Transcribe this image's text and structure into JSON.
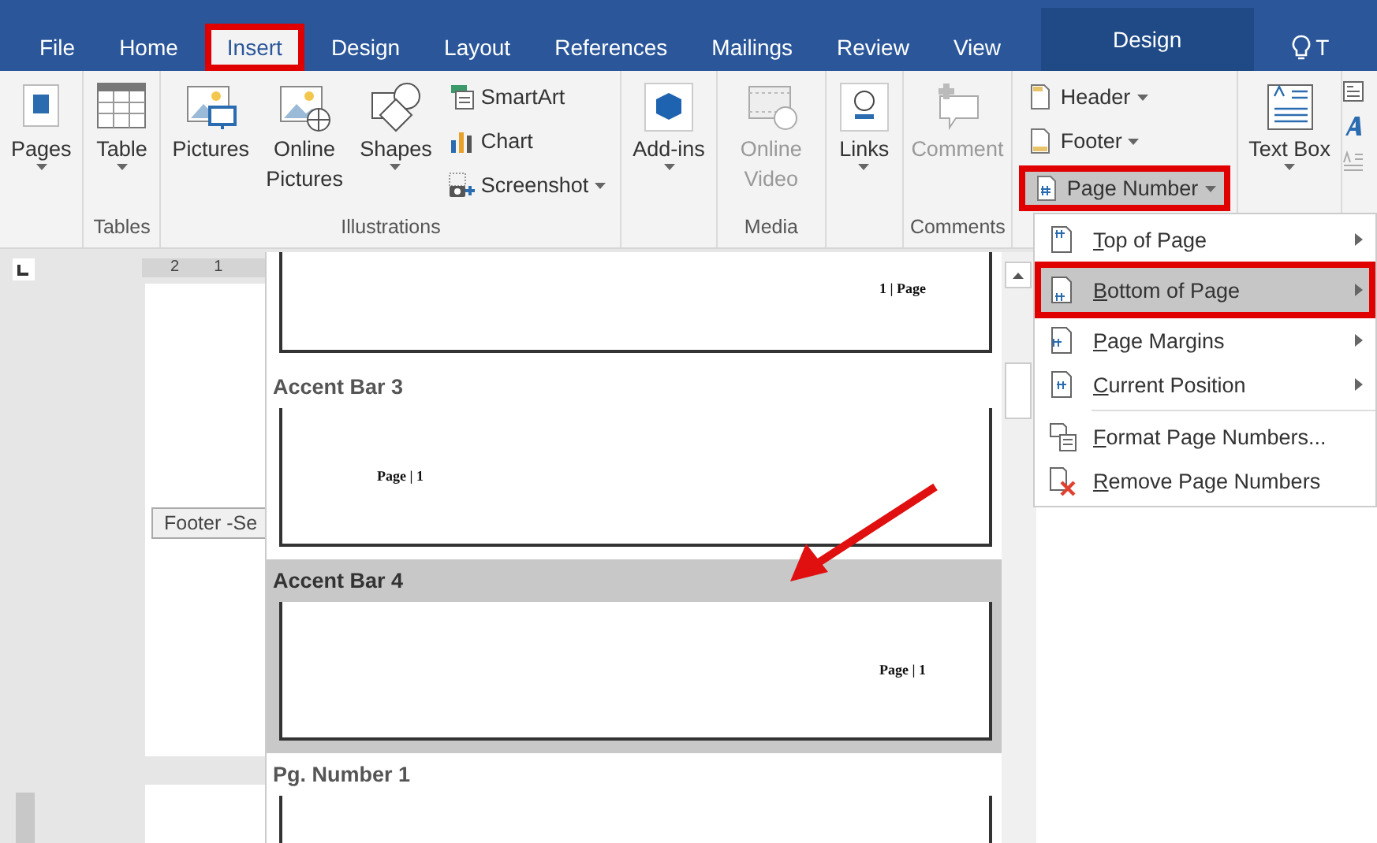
{
  "tabs": [
    {
      "label": "File",
      "selected": false,
      "highlighted": false,
      "kind": "normal"
    },
    {
      "label": "Home",
      "selected": false,
      "highlighted": false,
      "kind": "normal"
    },
    {
      "label": "Insert",
      "selected": true,
      "highlighted": true,
      "kind": "normal"
    },
    {
      "label": "Design",
      "selected": false,
      "highlighted": false,
      "kind": "normal"
    },
    {
      "label": "Layout",
      "selected": false,
      "highlighted": false,
      "kind": "normal"
    },
    {
      "label": "References",
      "selected": false,
      "highlighted": false,
      "kind": "normal"
    },
    {
      "label": "Mailings",
      "selected": false,
      "highlighted": false,
      "kind": "normal"
    },
    {
      "label": "Review",
      "selected": false,
      "highlighted": false,
      "kind": "normal"
    },
    {
      "label": "View",
      "selected": false,
      "highlighted": false,
      "kind": "normal"
    },
    {
      "label": "Design",
      "selected": false,
      "highlighted": false,
      "kind": "contextual"
    }
  ],
  "tell_me": {
    "text": "T"
  },
  "ribbon": {
    "groups": [
      {
        "items": [
          {
            "kind": "large",
            "label": "Pages",
            "dropdown": true,
            "disabled": false
          }
        ]
      },
      {
        "label": "Tables",
        "items": [
          {
            "kind": "large",
            "label": "Table",
            "dropdown": true,
            "disabled": false
          }
        ]
      },
      {
        "label": "Illustrations",
        "items": [
          {
            "kind": "large",
            "label": "Pictures",
            "dropdown": false,
            "disabled": false
          },
          {
            "kind": "large",
            "label": "Online Pictures",
            "dropdown": false,
            "disabled": false
          },
          {
            "kind": "large",
            "label": "Shapes",
            "dropdown": true,
            "disabled": false
          },
          {
            "kind": "small",
            "label": "SmartArt",
            "dropdown": false,
            "disabled": false
          },
          {
            "kind": "small",
            "label": "Chart",
            "dropdown": false,
            "disabled": false
          },
          {
            "kind": "small",
            "label": "Screenshot",
            "dropdown": true,
            "disabled": false
          }
        ]
      },
      {
        "items": [
          {
            "kind": "large",
            "label": "Add-ins",
            "dropdown": true,
            "disabled": false
          }
        ]
      },
      {
        "label": "Media",
        "items": [
          {
            "kind": "large",
            "label": "Online Video",
            "dropdown": false,
            "disabled": true
          }
        ]
      },
      {
        "items": [
          {
            "kind": "large",
            "label": "Links",
            "dropdown": true,
            "disabled": false
          }
        ]
      },
      {
        "label": "Comments",
        "items": [
          {
            "kind": "large",
            "label": "Comment",
            "dropdown": false,
            "disabled": true
          }
        ]
      },
      {
        "items": [
          {
            "kind": "small",
            "label": "Header",
            "dropdown": true,
            "disabled": false,
            "highlighted": false
          },
          {
            "kind": "small",
            "label": "Footer",
            "dropdown": true,
            "disabled": false,
            "highlighted": false
          },
          {
            "kind": "small",
            "label": "Page Number",
            "dropdown": true,
            "disabled": false,
            "highlighted": true
          }
        ]
      },
      {
        "items": [
          {
            "kind": "large",
            "label": "Text Box",
            "dropdown": true,
            "disabled": false
          }
        ]
      }
    ]
  },
  "ruler": {
    "numbers": [
      "2",
      "1"
    ]
  },
  "footer_tag": {
    "text": "Footer -Se"
  },
  "gallery": {
    "entries": [
      {
        "preview": "1 | Page",
        "kind": "right",
        "selected": false
      },
      {
        "title": "Accent Bar 3",
        "preview": "Page | 1",
        "kind": "left",
        "selected": false
      },
      {
        "title": "Accent Bar 4",
        "preview": "Page | 1",
        "kind": "right",
        "selected": true
      },
      {
        "title": "Pg. Number 1",
        "selected": false
      }
    ]
  },
  "menu": {
    "items": [
      {
        "label": "Top of Page",
        "submenu": true,
        "selected": false,
        "highlighted": false
      },
      {
        "label": "Bottom of Page",
        "submenu": true,
        "selected": true,
        "highlighted": true
      },
      {
        "label": "Page Margins",
        "submenu": true,
        "selected": false,
        "highlighted": false
      },
      {
        "label": "Current Position",
        "submenu": true,
        "selected": false,
        "highlighted": false
      },
      {
        "label": "Format Page Numbers...",
        "submenu": false,
        "selected": false,
        "highlighted": false
      },
      {
        "label": "Remove Page Numbers",
        "submenu": false,
        "selected": false,
        "highlighted": false
      }
    ]
  }
}
